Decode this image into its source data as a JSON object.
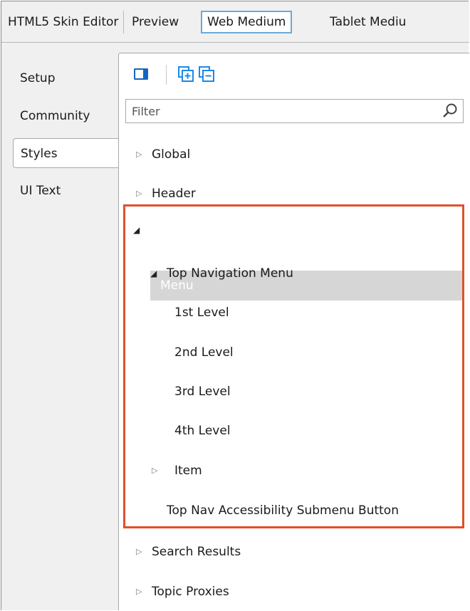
{
  "top_tabs": [
    {
      "label": "HTML5 Skin Editor"
    },
    {
      "label": "Preview"
    },
    {
      "label": "Web Medium"
    },
    {
      "label": "Tablet Mediu"
    }
  ],
  "side_tabs": [
    {
      "label": "Setup"
    },
    {
      "label": "Community"
    },
    {
      "label": "Styles"
    },
    {
      "label": "UI Text"
    }
  ],
  "filter": {
    "placeholder": "Filter"
  },
  "tree": {
    "global": "Global",
    "header": "Header",
    "menu": "Menu",
    "top_nav_menu": "Top Navigation Menu",
    "level1": "1st Level",
    "level2": "2nd Level",
    "level3": "3rd Level",
    "level4": "4th Level",
    "item": "Item",
    "accessibility": "Top Nav Accessibility Submenu Button",
    "search_results": "Search Results",
    "topic_proxies": "Topic Proxies"
  },
  "colors": {
    "highlight_border": "#e0502b",
    "active_tab_border": "#6aa9d8",
    "toolbar_icon_blue": "#1565c0",
    "selected_row_bg": "#d6d6d6"
  },
  "icons": {
    "toggle_panel": "panel-toggle-icon",
    "expand_all": "expand-all-icon",
    "collapse_all": "collapse-all-icon",
    "search": "search-icon"
  }
}
